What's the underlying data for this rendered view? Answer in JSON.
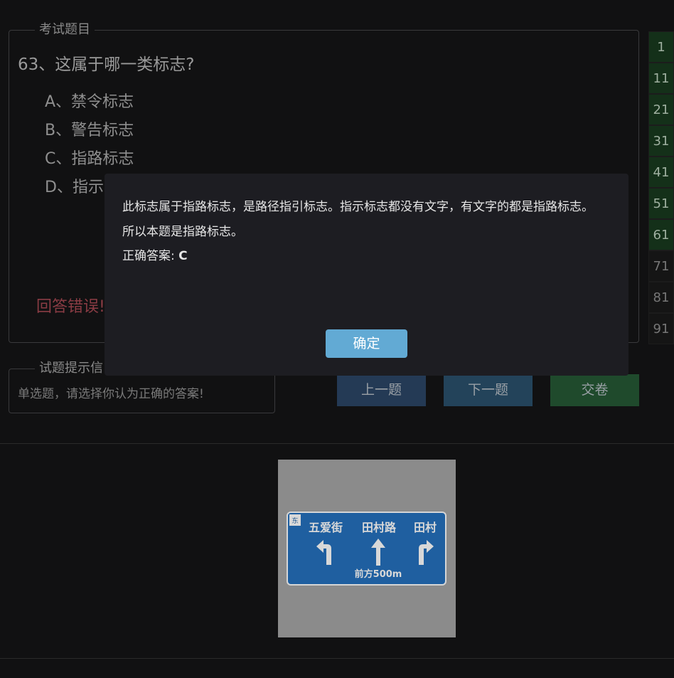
{
  "question_box": {
    "legend": "考试题目",
    "question": "63、这属于哪一类标志?",
    "options": [
      "A、禁令标志",
      "B、警告标志",
      "C、指路标志",
      "D、指示"
    ],
    "result": "回答错误!"
  },
  "hint_box": {
    "legend": "试题提示信",
    "text": "单选题，请选择你认为正确的答案!"
  },
  "buttons": {
    "prev": "上一题",
    "next": "下一题",
    "submit": "交卷"
  },
  "nav": [
    {
      "label": "1",
      "done": true
    },
    {
      "label": "11",
      "done": true
    },
    {
      "label": "21",
      "done": true
    },
    {
      "label": "31",
      "done": true
    },
    {
      "label": "41",
      "done": true
    },
    {
      "label": "51",
      "done": true
    },
    {
      "label": "61",
      "done": true
    },
    {
      "label": "71",
      "done": false
    },
    {
      "label": "81",
      "done": false
    },
    {
      "label": "91",
      "done": false
    }
  ],
  "sign": {
    "corner": "东",
    "dest_left": "五爱街",
    "dest_center": "田村路",
    "dest_right": "田村",
    "distance": "前方500m",
    "bg_color": "#1f5fa0"
  },
  "modal": {
    "line1": "此标志属于指路标志，是路径指引标志。指示标志都没有文字，有文字的都是指路标志。",
    "line2": "所以本题是指路标志。",
    "answer_label": "正确答案:",
    "answer_value": "C",
    "ok": "确定"
  }
}
